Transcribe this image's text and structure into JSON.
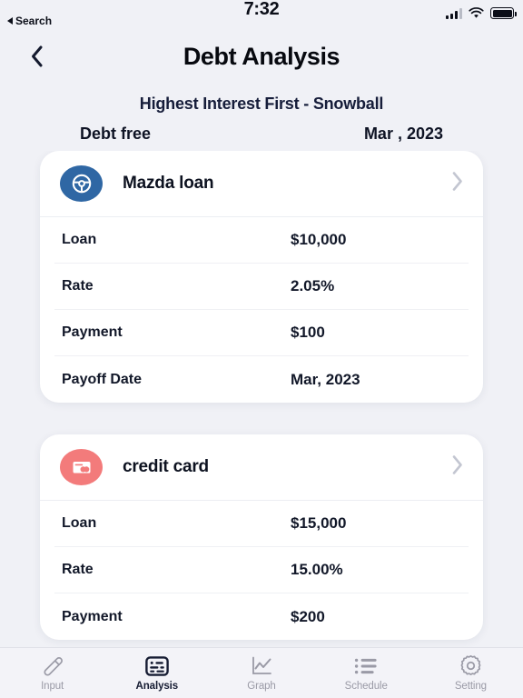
{
  "status_bar": {
    "time": "7:32",
    "back_label": "Search",
    "signal_icon": "signal-bars-icon",
    "wifi_icon": "wifi-icon",
    "battery_icon": "battery-full-icon"
  },
  "nav": {
    "back_icon": "chevron-left-icon",
    "title": "Debt Analysis"
  },
  "summary": {
    "strategy": "Highest Interest First - Snowball",
    "debt_free_label": "Debt free",
    "debt_free_date": "Mar , 2023"
  },
  "colors": {
    "page_bg": "#f0f1f6",
    "card_bg": "#ffffff",
    "text": "#121829",
    "accent_blue": "#2f67a4",
    "accent_coral": "#f37b7b",
    "chevron": "#c3c6d1",
    "tab_inactive": "#9a9aa6",
    "tab_active": "#161c33"
  },
  "debts": [
    {
      "name": "Mazda loan",
      "icon": "steering-wheel-icon",
      "icon_color": "#2f67a4",
      "chevron_icon": "chevron-right-icon",
      "rows": [
        {
          "label": "Loan",
          "value": "$10,000"
        },
        {
          "label": "Rate",
          "value": "2.05%"
        },
        {
          "label": "Payment",
          "value": "$100"
        },
        {
          "label": "Payoff Date",
          "value": "Mar, 2023"
        }
      ]
    },
    {
      "name": "credit card",
      "icon": "credit-card-icon",
      "icon_color": "#f37b7b",
      "chevron_icon": "chevron-right-icon",
      "rows": [
        {
          "label": "Loan",
          "value": "$15,000"
        },
        {
          "label": "Rate",
          "value": "15.00%"
        },
        {
          "label": "Payment",
          "value": "$200"
        }
      ]
    }
  ],
  "tabs": [
    {
      "label": "Input",
      "icon": "pencil-icon",
      "active": false
    },
    {
      "label": "Analysis",
      "icon": "register-icon",
      "active": true
    },
    {
      "label": "Graph",
      "icon": "line-chart-icon",
      "active": false
    },
    {
      "label": "Schedule",
      "icon": "list-icon",
      "active": false
    },
    {
      "label": "Setting",
      "icon": "gear-icon",
      "active": false
    }
  ]
}
